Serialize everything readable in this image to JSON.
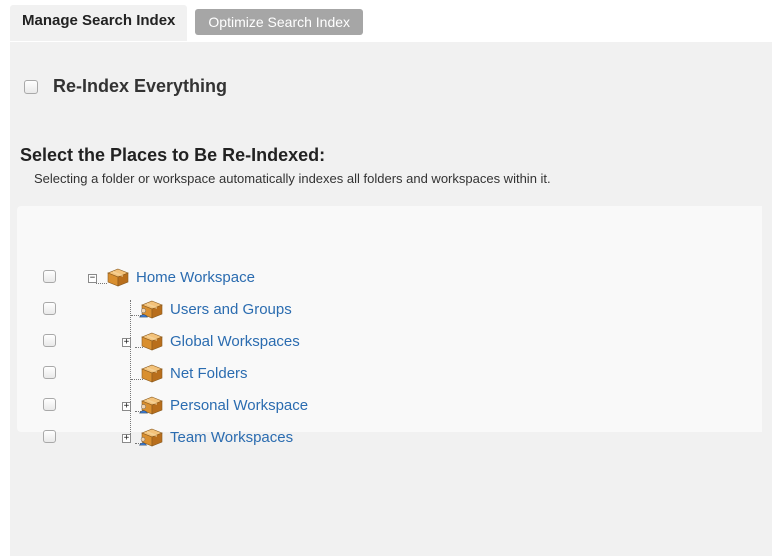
{
  "tabs": {
    "manage": "Manage Search Index",
    "optimize": "Optimize Search Index"
  },
  "reindex_everything": {
    "label": "Re-Index Everything",
    "checked": false
  },
  "places": {
    "title": "Select the Places to Be Re-Indexed:",
    "description": "Selecting a folder or workspace automatically indexes all folders and workspaces within it."
  },
  "tree": {
    "items": [
      {
        "label": "Home Workspace",
        "icon": "workspace-box-icon",
        "expander": "collapse",
        "checked": false
      },
      {
        "label": "Users and Groups",
        "icon": "users-box-icon",
        "expander": "none",
        "checked": false
      },
      {
        "label": "Global Workspaces",
        "icon": "workspace-box-icon",
        "expander": "expand",
        "checked": false
      },
      {
        "label": "Net Folders",
        "icon": "workspace-box-icon",
        "expander": "none",
        "checked": false
      },
      {
        "label": "Personal Workspace",
        "icon": "users-box-icon",
        "expander": "expand",
        "checked": false
      },
      {
        "label": "Team Workspaces",
        "icon": "team-box-icon",
        "expander": "expand",
        "checked": false
      }
    ]
  },
  "colors": {
    "link": "#2b6cb0",
    "panel_bg": "#f1f1f1",
    "tree_bg": "#f9f9f9",
    "inactive_tab_bg": "#a6a6a6"
  }
}
